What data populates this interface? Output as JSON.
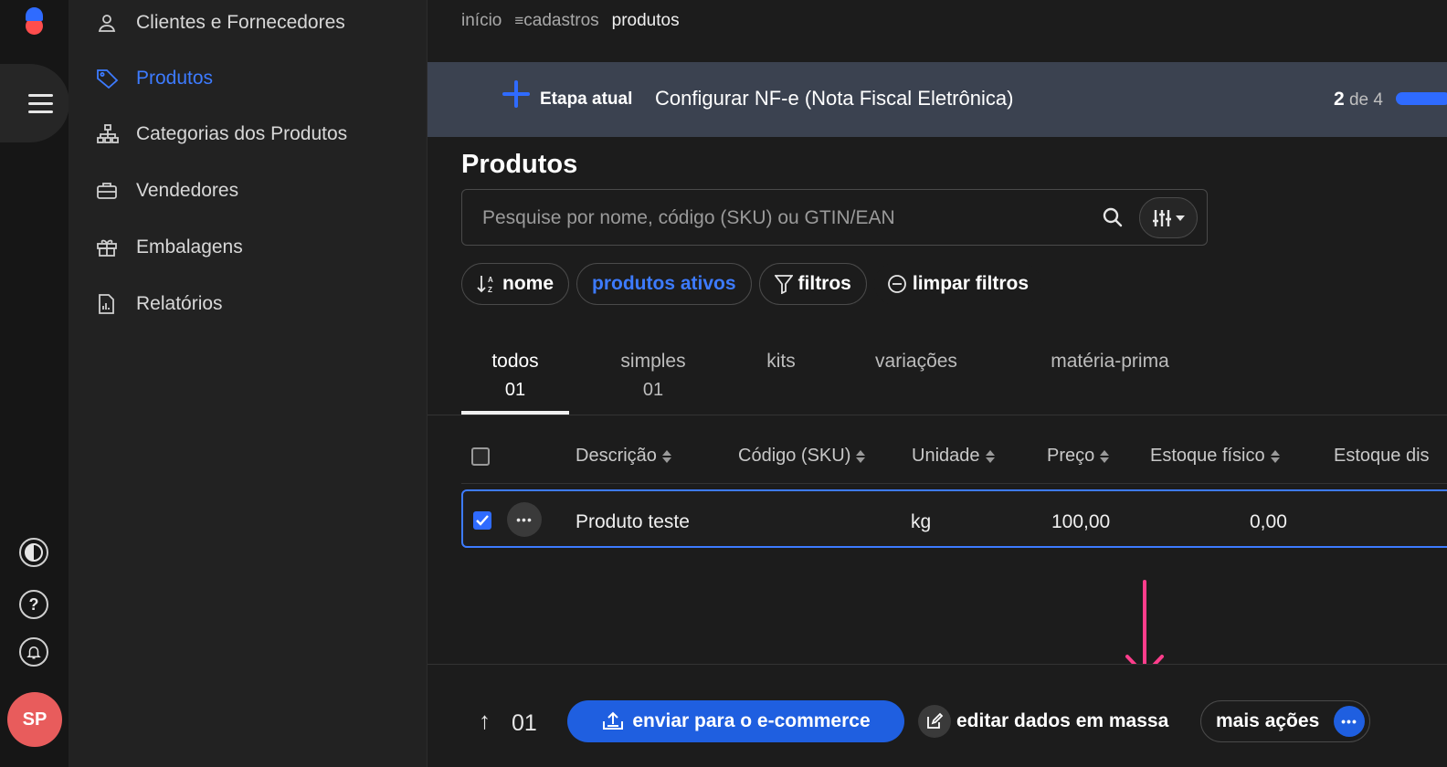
{
  "rail": {
    "avatar_initials": "SP"
  },
  "sidebar": {
    "items": [
      {
        "label": "Clientes e Fornecedores",
        "icon": "person-icon",
        "active": false
      },
      {
        "label": "Produtos",
        "icon": "tag-icon",
        "active": true
      },
      {
        "label": "Categorias dos Produtos",
        "icon": "hierarchy-icon",
        "active": false
      },
      {
        "label": "Vendedores",
        "icon": "briefcase-icon",
        "active": false
      },
      {
        "label": "Embalagens",
        "icon": "gift-icon",
        "active": false
      },
      {
        "label": "Relatórios",
        "icon": "report-icon",
        "active": false
      }
    ]
  },
  "breadcrumb": {
    "home": "início",
    "section": "cadastros",
    "current": "produtos"
  },
  "banner": {
    "label": "Etapa atual",
    "step": "Configurar NF-e (Nota Fiscal Eletrônica)",
    "current_step": "2",
    "of_label": "de 4"
  },
  "page": {
    "title": "Produtos"
  },
  "search": {
    "placeholder": "Pesquise por nome, código (SKU) ou GTIN/EAN",
    "value": ""
  },
  "chips": {
    "sort": "nome",
    "status": "produtos ativos",
    "filters": "filtros",
    "clear": "limpar filtros"
  },
  "tabs": [
    {
      "label": "todos",
      "count": "01"
    },
    {
      "label": "simples",
      "count": "01"
    },
    {
      "label": "kits",
      "count": ""
    },
    {
      "label": "variações",
      "count": ""
    },
    {
      "label": "matéria-prima",
      "count": ""
    }
  ],
  "table": {
    "headers": {
      "description": "Descrição",
      "sku": "Código (SKU)",
      "unit": "Unidade",
      "price": "Preço",
      "stock": "Estoque físico",
      "available": "Estoque dis"
    },
    "rows": [
      {
        "description": "Produto teste",
        "sku": "",
        "unit": "kg",
        "price": "100,00",
        "stock": "0,00",
        "checked": true
      }
    ]
  },
  "footer": {
    "selected_count": "01",
    "send_button": "enviar para o e-commerce",
    "edit_button": "editar dados em massa",
    "more_button": "mais ações"
  },
  "colors": {
    "accent": "#1f5fe0",
    "link": "#3d7bff",
    "annotation_arrow": "#ff3d8b",
    "avatar": "#e85c5c",
    "banner": "#3b4250"
  }
}
